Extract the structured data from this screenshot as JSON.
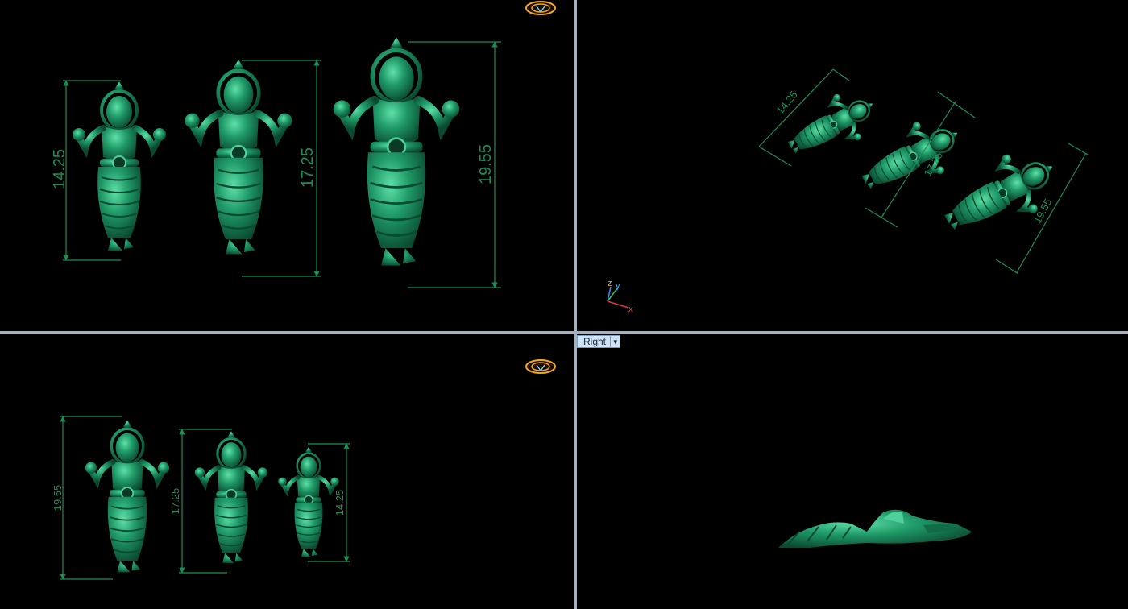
{
  "viewports": {
    "top_left": {
      "dimensions": [
        "14.25",
        "17.25",
        "19.55"
      ]
    },
    "top_right": {
      "dimensions": [
        "14.25",
        "17.25",
        "19.55"
      ],
      "axis_labels": {
        "z": "z",
        "y": "y",
        "x": "x"
      }
    },
    "bottom_left": {
      "dimensions": [
        "19.55",
        "17.25",
        "14.25"
      ]
    },
    "bottom_right": {
      "view_name": "Right",
      "dropdown_icon": "chevron-down-icon"
    }
  },
  "colors": {
    "model": "#1f8f63",
    "dimension": "#1a8f55",
    "divider": "#9fb3c8",
    "background": "#000000"
  }
}
